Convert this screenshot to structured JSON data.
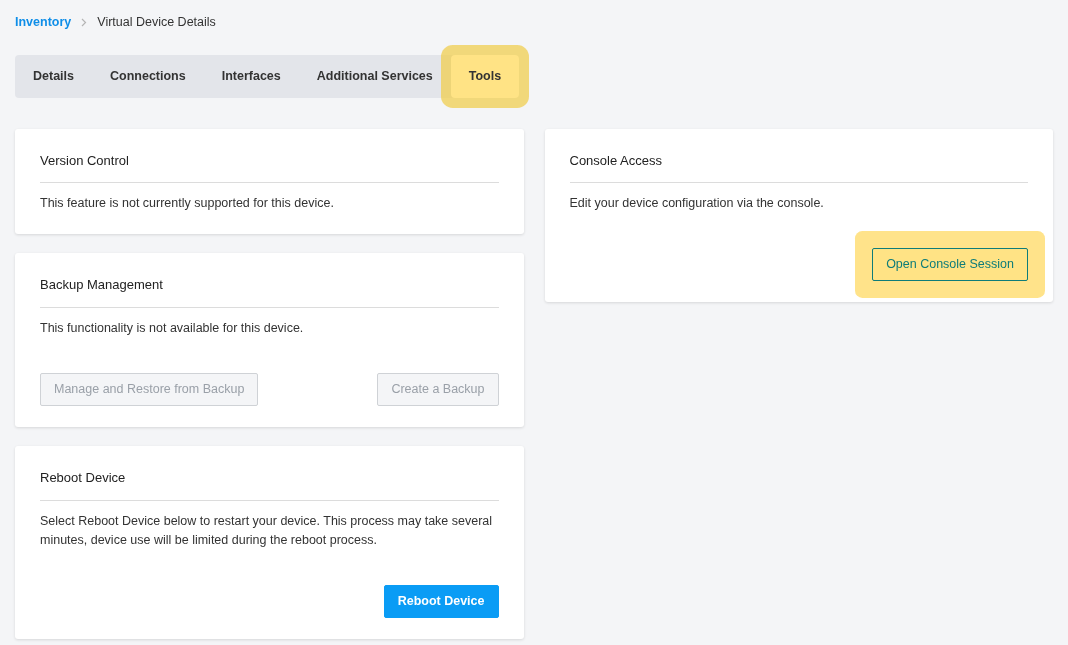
{
  "breadcrumb": [
    {
      "label": "Inventory",
      "link": true
    },
    {
      "label": "Virtual Device Details",
      "link": false
    }
  ],
  "tabs": [
    {
      "label": "Details",
      "selected": false,
      "highlighted": false
    },
    {
      "label": "Connections",
      "selected": false,
      "highlighted": false
    },
    {
      "label": "Interfaces",
      "selected": false,
      "highlighted": false
    },
    {
      "label": "Additional Services",
      "selected": false,
      "highlighted": false
    },
    {
      "label": "Tools",
      "selected": true,
      "highlighted": true
    }
  ],
  "left_cards": [
    {
      "title": "Version Control",
      "text": "This feature is not currently supported for this device."
    },
    {
      "title": "Backup Management",
      "text": "This functionality is not available for this device.",
      "buttons": [
        {
          "label": "Manage and Restore from Backup",
          "kind": "outline",
          "disabled": true,
          "highlighted": false
        },
        {
          "label": "Create a Backup",
          "kind": "outline",
          "disabled": true,
          "highlighted": false
        }
      ]
    },
    {
      "title": "Reboot Device",
      "text": "Select Reboot Device below to restart your device. This process may take several minutes, device use will be limited during the reboot process.",
      "buttons": [
        {
          "label": "Reboot Device",
          "kind": "primary",
          "disabled": false,
          "highlighted": false
        }
      ]
    }
  ],
  "right_cards": [
    {
      "title": "Console Access",
      "text": "Edit your device configuration via the console.",
      "buttons": [
        {
          "label": "Open Console Session",
          "kind": "outline",
          "disabled": false,
          "highlighted": true
        }
      ]
    }
  ]
}
